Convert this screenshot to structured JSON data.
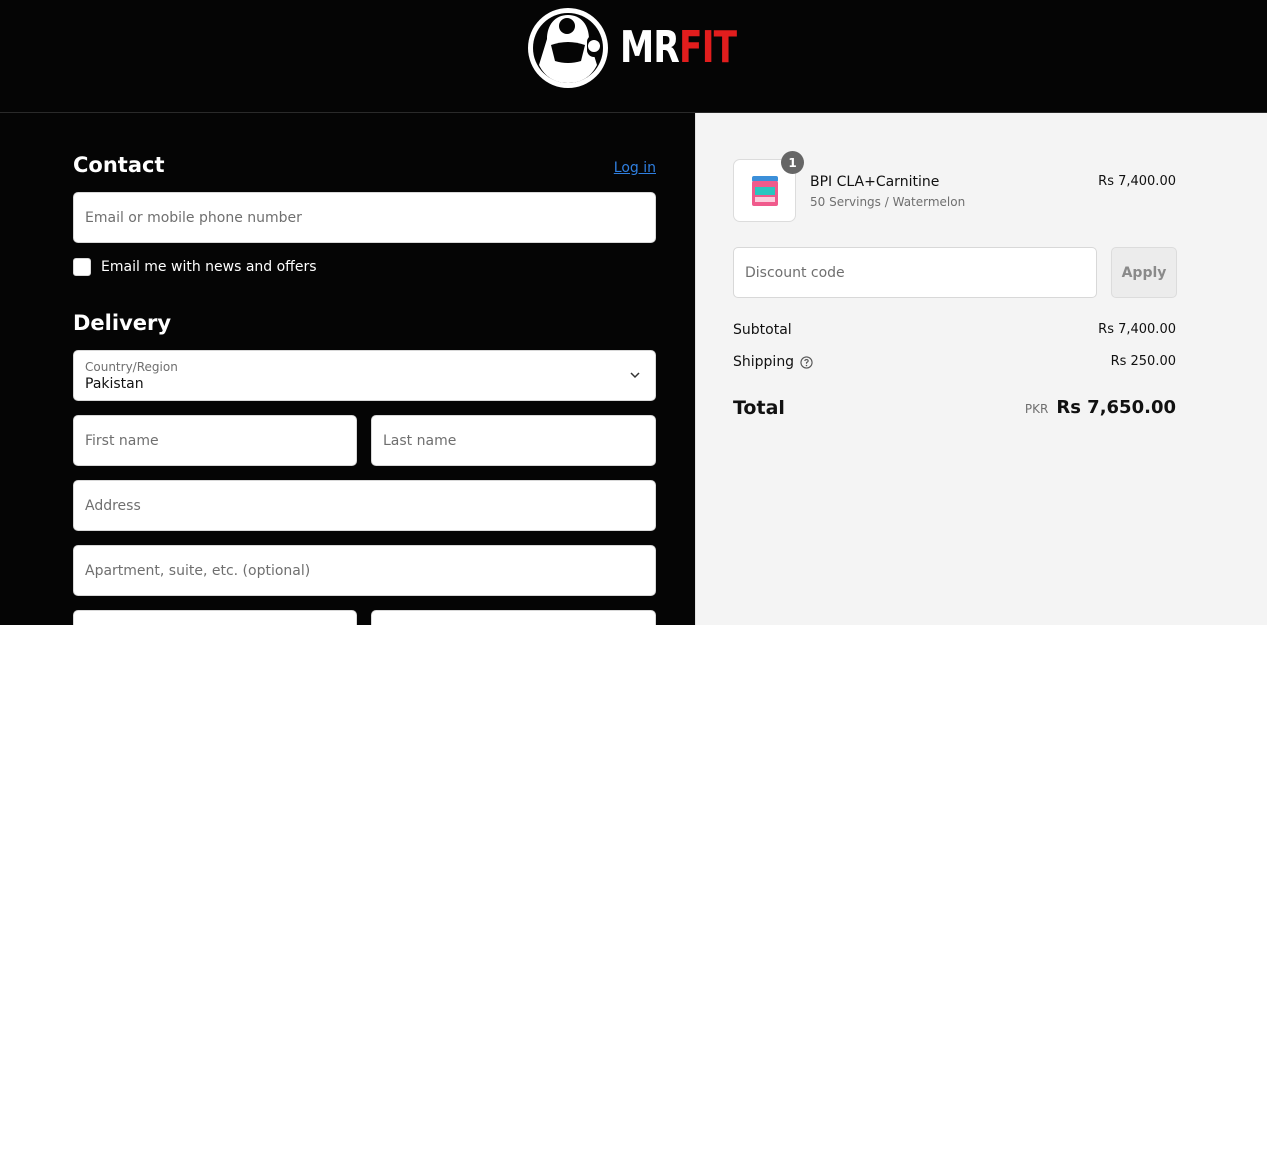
{
  "brand": {
    "mr": "MR",
    "fit": "FIT",
    "accent_color": "#e21d1d"
  },
  "contact": {
    "title": "Contact",
    "login_label": "Log in",
    "email_placeholder": "Email or mobile phone number",
    "newsletter_label": "Email me with news and offers"
  },
  "delivery": {
    "title": "Delivery",
    "country_label": "Country/Region",
    "country_value": "Pakistan",
    "first_name_placeholder": "First name",
    "last_name_placeholder": "Last name",
    "address_placeholder": "Address",
    "apartment_placeholder": "Apartment, suite, etc. (optional)"
  },
  "order": {
    "product": {
      "name": "BPI CLA+Carnitine",
      "variant": "50 Servings / Watermelon",
      "price": "Rs 7,400.00",
      "quantity": "1"
    },
    "discount_placeholder": "Discount code",
    "apply_label": "Apply",
    "subtotal_label": "Subtotal",
    "subtotal_value": "Rs 7,400.00",
    "shipping_label": "Shipping",
    "shipping_value": "Rs 250.00",
    "total_label": "Total",
    "currency": "PKR",
    "total_value": "Rs 7,650.00"
  }
}
